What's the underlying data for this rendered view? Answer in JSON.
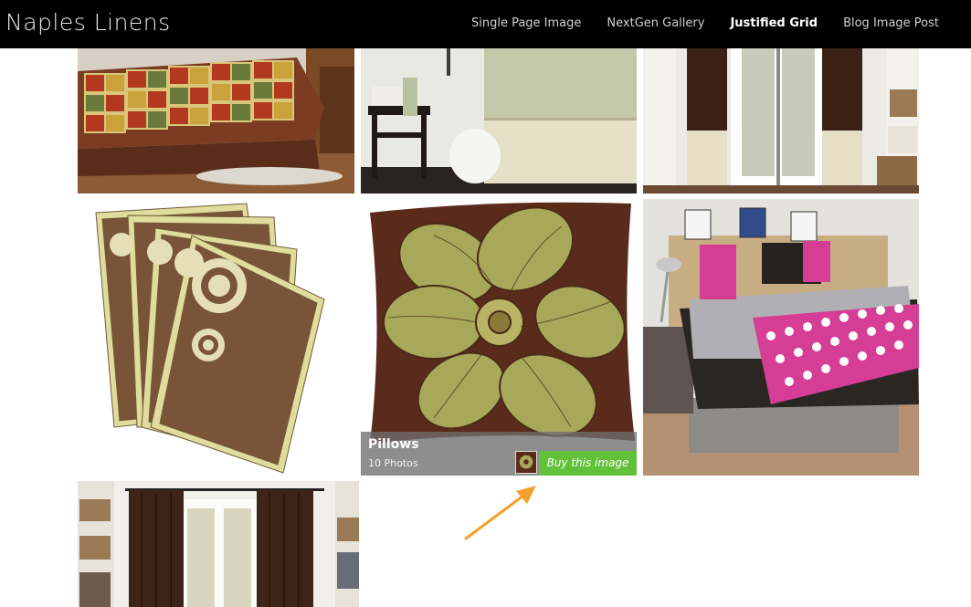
{
  "site": {
    "title": "Naples Linens"
  },
  "nav": {
    "items": [
      {
        "label": "Single Page Image"
      },
      {
        "label": "NextGen Gallery"
      },
      {
        "label": "Justified Grid"
      },
      {
        "label": "Blog Image Post"
      }
    ],
    "active_index": 2
  },
  "gallery": {
    "hovered_album": {
      "title": "Pillows",
      "count": "10 Photos",
      "buy_label": "Buy this image"
    }
  },
  "colors": {
    "buy_button": "#62c13b",
    "arrow": "#f3a12a",
    "header": "#000000"
  }
}
